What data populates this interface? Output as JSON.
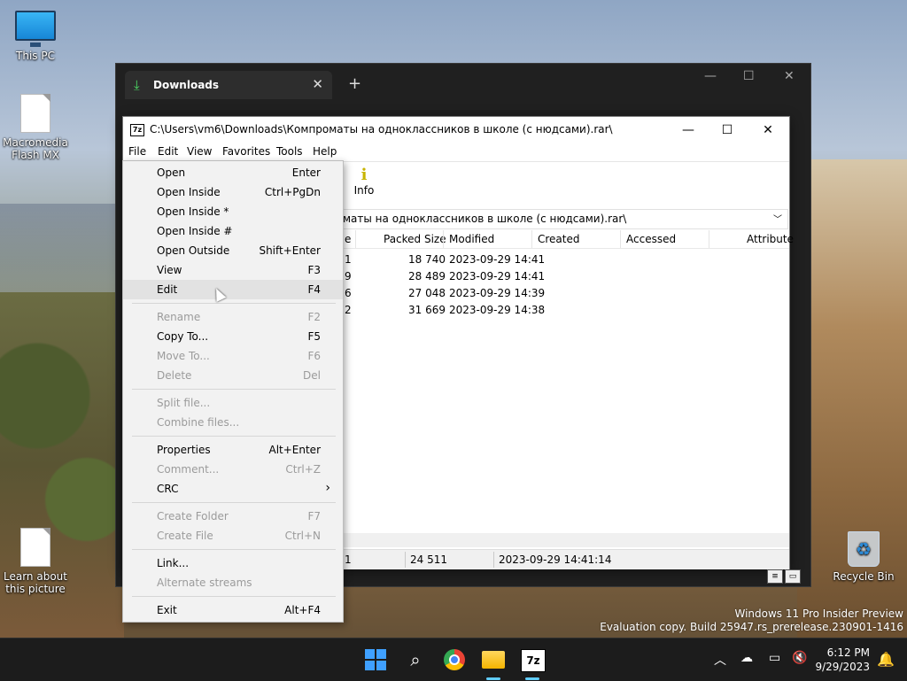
{
  "desktop": {
    "icons": [
      {
        "label": "This PC"
      },
      {
        "label": "Macromedia Flash MX"
      },
      {
        "label": "Learn about this picture"
      },
      {
        "label": "Recycle Bin"
      }
    ],
    "watermark_line1": "Windows 11 Pro Insider Preview",
    "watermark_line2": "Evaluation copy. Build 25947.rs_prerelease.230901-1416"
  },
  "explorer": {
    "tab_title": "Downloads",
    "tab_close": "✕",
    "new_tab": "+",
    "min": "—",
    "max": "☐",
    "close": "✕"
  },
  "sevenzip": {
    "title_path": "C:\\Users\\vm6\\Downloads\\Компроматы на одноклассников в школе (с нюдсами).rar\\",
    "logo": "7z",
    "menu": [
      "File",
      "Edit",
      "View",
      "Favorites",
      "Tools",
      "Help"
    ],
    "toolbar": {
      "info_label": "Info",
      "info_icon": "i"
    },
    "address_visible": "маты на одноклассников в школе (с нюдсами).rar\\",
    "columns": {
      "size": "e",
      "packed": "Packed Size",
      "modified": "Modified",
      "created": "Created",
      "accessed": "Accessed",
      "attributes": "Attribute"
    },
    "rows": [
      {
        "size": "1",
        "packed": "18 740",
        "modified": "2023-09-29 14:41"
      },
      {
        "size": "9",
        "packed": "28 489",
        "modified": "2023-09-29 14:41"
      },
      {
        "size": "6",
        "packed": "27 048",
        "modified": "2023-09-29 14:39"
      },
      {
        "size": "2",
        "packed": "31 669",
        "modified": "2023-09-29 14:38"
      }
    ],
    "status": {
      "s1": "1",
      "s2": "24 511",
      "s3": "2023-09-29 14:41:14"
    }
  },
  "file_menu": {
    "items": [
      {
        "label": "Open",
        "shortcut": "Enter"
      },
      {
        "label": "Open Inside",
        "shortcut": "Ctrl+PgDn"
      },
      {
        "label": "Open Inside *",
        "shortcut": ""
      },
      {
        "label": "Open Inside #",
        "shortcut": ""
      },
      {
        "label": "Open Outside",
        "shortcut": "Shift+Enter"
      },
      {
        "label": "View",
        "shortcut": "F3"
      },
      {
        "label": "Edit",
        "shortcut": "F4"
      },
      {
        "label": "Rename",
        "shortcut": "F2"
      },
      {
        "label": "Copy To...",
        "shortcut": "F5"
      },
      {
        "label": "Move To...",
        "shortcut": "F6"
      },
      {
        "label": "Delete",
        "shortcut": "Del"
      },
      {
        "label": "Split file...",
        "shortcut": ""
      },
      {
        "label": "Combine files...",
        "shortcut": ""
      },
      {
        "label": "Properties",
        "shortcut": "Alt+Enter"
      },
      {
        "label": "Comment...",
        "shortcut": "Ctrl+Z"
      },
      {
        "label": "CRC",
        "shortcut": ""
      },
      {
        "label": "Create Folder",
        "shortcut": "F7"
      },
      {
        "label": "Create File",
        "shortcut": "Ctrl+N"
      },
      {
        "label": "Link...",
        "shortcut": ""
      },
      {
        "label": "Alternate streams",
        "shortcut": ""
      },
      {
        "label": "Exit",
        "shortcut": "Alt+F4"
      }
    ]
  },
  "taskbar": {
    "time": "6:12 PM",
    "date": "9/29/2023"
  },
  "colors": {
    "accent": "#60cdff",
    "taskbar": "#1c1c1c",
    "menu_bg": "#f2f2f2"
  }
}
